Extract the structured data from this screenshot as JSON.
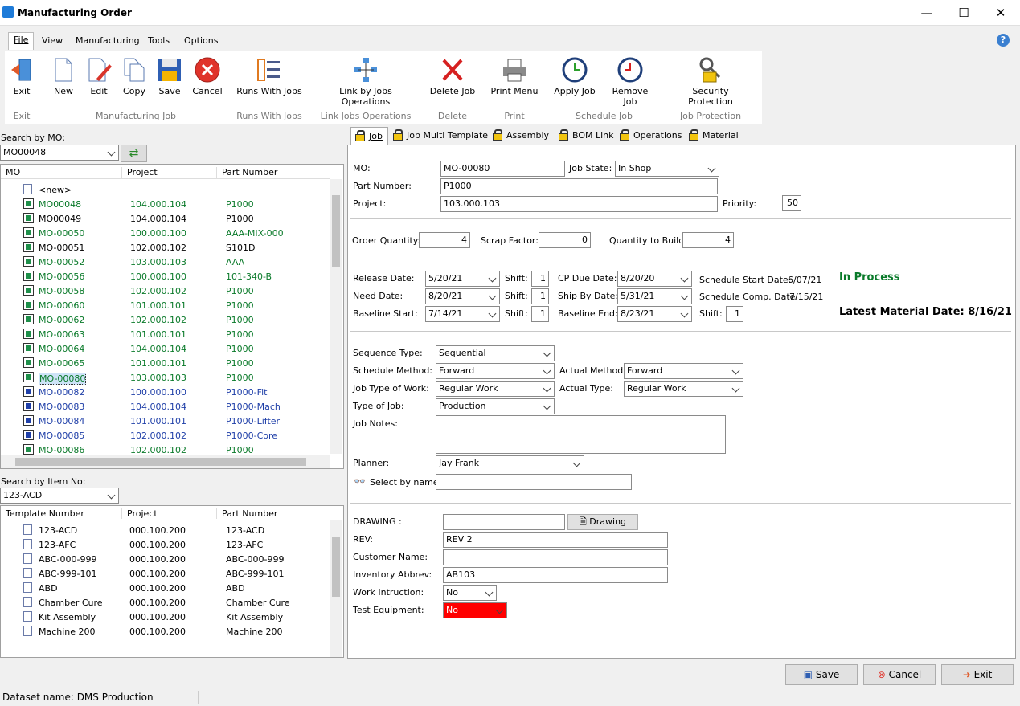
{
  "window": {
    "title": "Manufacturing Order",
    "minimize": "—",
    "maximize": "☐",
    "close": "✕"
  },
  "menu": {
    "file": "File",
    "view": "View",
    "manufacturing": "Manufacturing",
    "tools": "Tools",
    "options": "Options",
    "help": "?"
  },
  "toolbar": {
    "exit": "Exit",
    "new": "New",
    "edit": "Edit",
    "copy": "Copy",
    "save": "Save",
    "cancel": "Cancel",
    "runs_with_jobs": "Runs With Jobs",
    "link_jobs": "Link by Jobs Operations",
    "delete_job": "Delete Job",
    "print_menu": "Print Menu",
    "apply_job": "Apply Job",
    "remove_job": "Remove Job",
    "security": "Security Protection",
    "groups": {
      "exit": "Exit",
      "manufacturing_job": "Manufacturing Job",
      "runs_with_jobs": "Runs With Jobs",
      "link_jobs_ops": "Link Jobs Operations",
      "delete": "Delete",
      "print": "Print",
      "schedule_job": "Schedule Job",
      "job_protection": "Job Protection"
    }
  },
  "mo_search": {
    "label": "Search by MO:",
    "value": "MO00048"
  },
  "mo_grid": {
    "headers": [
      "MO",
      "Project",
      "Part Number"
    ],
    "new_row": "<new>",
    "rows": [
      {
        "mo": "MO00048",
        "project": "104.000.104",
        "part": "P1000",
        "color": "#0a7a2a"
      },
      {
        "mo": "MO00049",
        "project": "104.000.104",
        "part": "P1000",
        "color": "#000000"
      },
      {
        "mo": "MO-00050",
        "project": "100.000.100",
        "part": "AAA-MIX-000",
        "color": "#0a7a2a"
      },
      {
        "mo": "MO-00051",
        "project": "102.000.102",
        "part": "S101D",
        "color": "#000000"
      },
      {
        "mo": "MO-00052",
        "project": "103.000.103",
        "part": "AAA",
        "color": "#0a7a2a"
      },
      {
        "mo": "MO-00056",
        "project": "100.000.100",
        "part": "101-340-B",
        "color": "#0a7a2a"
      },
      {
        "mo": "MO-00058",
        "project": "102.000.102",
        "part": "P1000",
        "color": "#0a7a2a"
      },
      {
        "mo": "MO-00060",
        "project": "101.000.101",
        "part": "P1000",
        "color": "#0a7a2a"
      },
      {
        "mo": "MO-00062",
        "project": "102.000.102",
        "part": "P1000",
        "color": "#0a7a2a"
      },
      {
        "mo": "MO-00063",
        "project": "101.000.101",
        "part": "P1000",
        "color": "#0a7a2a"
      },
      {
        "mo": "MO-00064",
        "project": "104.000.104",
        "part": "P1000",
        "color": "#0a7a2a"
      },
      {
        "mo": "MO-00065",
        "project": "101.000.101",
        "part": "P1000",
        "color": "#0a7a2a"
      },
      {
        "mo": "MO-00080",
        "project": "103.000.103",
        "part": "P1000",
        "color": "#0a7a2a"
      },
      {
        "mo": "MO-00082",
        "project": "100.000.100",
        "part": "P1000-Fit",
        "color": "#1f3fa8"
      },
      {
        "mo": "MO-00083",
        "project": "104.000.104",
        "part": "P1000-Mach",
        "color": "#1f3fa8"
      },
      {
        "mo": "MO-00084",
        "project": "101.000.101",
        "part": "P1000-Lifter",
        "color": "#1f3fa8"
      },
      {
        "mo": "MO-00085",
        "project": "102.000.102",
        "part": "P1000-Core",
        "color": "#1f3fa8"
      },
      {
        "mo": "MO-00086",
        "project": "102.000.102",
        "part": "P1000",
        "color": "#0a7a2a"
      }
    ]
  },
  "item_search": {
    "label": "Search by Item No:",
    "value": "123-ACD"
  },
  "template_grid": {
    "headers": [
      "Template Number",
      "Project",
      "Part Number"
    ],
    "rows": [
      {
        "t": "123-ACD",
        "project": "000.100.200",
        "part": "123-ACD"
      },
      {
        "t": "123-AFC",
        "project": "000.100.200",
        "part": "123-AFC"
      },
      {
        "t": "ABC-000-999",
        "project": "000.100.200",
        "part": "ABC-000-999"
      },
      {
        "t": "ABC-999-101",
        "project": "000.100.200",
        "part": "ABC-999-101"
      },
      {
        "t": "ABD",
        "project": "000.100.200",
        "part": "ABD"
      },
      {
        "t": "Chamber Cure",
        "project": "000.100.200",
        "part": "Chamber Cure"
      },
      {
        "t": "Kit Assembly",
        "project": "000.100.200",
        "part": "Kit Assembly"
      },
      {
        "t": "Machine 200",
        "project": "000.100.200",
        "part": "Machine 200"
      }
    ]
  },
  "tabs": [
    "Job",
    "Job Multi Template",
    "Assembly",
    "BOM Link",
    "Operations",
    "Material"
  ],
  "job": {
    "mo_label": "MO:",
    "mo": "MO-00080",
    "job_state_label": "Job State:",
    "job_state": "In Shop",
    "part_label": "Part Number:",
    "part": "P1000",
    "project_label": "Project:",
    "project": "103.000.103",
    "priority_label": "Priority:",
    "priority": "50",
    "order_qty_label": "Order Quantity:",
    "order_qty": "4",
    "scrap_label": "Scrap Factor:",
    "scrap": "0",
    "qty_build_label": "Quantity to Build:",
    "qty_build": "4",
    "release_label": "Release Date:",
    "release": "5/20/21",
    "shift_label": "Shift:",
    "shift1": "1",
    "cp_due_label": "CP Due Date:",
    "cp_due": "8/20/20",
    "sched_start_label": "Schedule Start Date:",
    "sched_start": "6/07/21",
    "need_label": "Need Date:",
    "need": "8/20/21",
    "shift2": "1",
    "ship_by_label": "Ship By Date:",
    "ship_by": "5/31/21",
    "sched_comp_label": "Schedule Comp. Date:",
    "sched_comp": "7/15/21",
    "baseline_start_label": "Baseline Start:",
    "baseline_start": "7/14/21",
    "shift3": "1",
    "baseline_end_label": "Baseline End:",
    "baseline_end": "8/23/21",
    "shift4": "1",
    "status": "In Process",
    "latest_material": "Latest Material Date: 8/16/21",
    "seq_type_label": "Sequence Type:",
    "seq_type": "Sequential",
    "sched_method_label": "Schedule Method:",
    "sched_method": "Forward",
    "actual_method_label": "Actual Method:",
    "actual_method": "Forward",
    "job_type_work_label": "Job Type of Work:",
    "job_type_work": "Regular Work",
    "actual_type_label": "Actual Type:",
    "actual_type": "Regular Work",
    "type_job_label": "Type of Job:",
    "type_job": "Production",
    "notes_label": "Job Notes:",
    "notes": "",
    "planner_label": "Planner:",
    "planner": "Jay Frank",
    "select_by_name_label": "Select by name",
    "select_by_name": "",
    "drawing_label": "DRAWING :",
    "drawing": "",
    "drawing_btn": "Drawing",
    "rev_label": "REV:",
    "rev": "REV 2",
    "customer_label": "Customer Name:",
    "customer": "",
    "inv_label": "Inventory Abbrev:",
    "inv": "AB103",
    "work_instr_label": "Work Intruction:",
    "work_instr": "No",
    "test_eq_label": "Test Equipment:",
    "test_eq": "No",
    "status_color": "#0a7a2a",
    "alert_color": "#ff0000"
  },
  "footer": {
    "save": "Save",
    "cancel": "Cancel",
    "exit": "Exit"
  },
  "status": {
    "dataset": "Dataset name:  DMS Production"
  }
}
